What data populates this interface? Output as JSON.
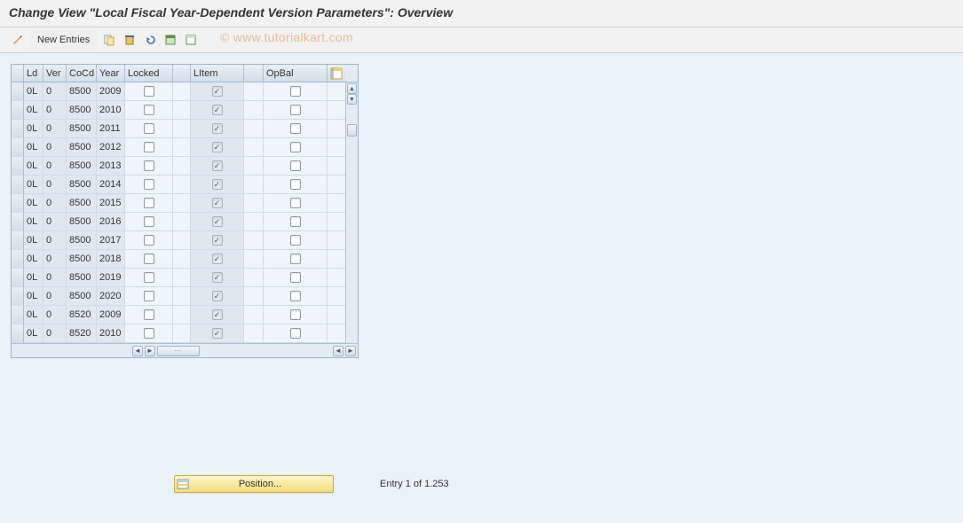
{
  "header": {
    "title": "Change View \"Local Fiscal Year-Dependent Version Parameters\": Overview"
  },
  "toolbar": {
    "new_entries": "New Entries"
  },
  "watermark": "© www.tutorialkart.com",
  "table": {
    "columns": {
      "ld": "Ld",
      "ver": "Ver",
      "cocd": "CoCd",
      "year": "Year",
      "locked": "Locked",
      "litem": "LItem",
      "opbal": "OpBal"
    },
    "rows": [
      {
        "ld": "0L",
        "ver": "0",
        "cocd": "8500",
        "year": "2009",
        "locked": false,
        "litem": true,
        "opbal": false
      },
      {
        "ld": "0L",
        "ver": "0",
        "cocd": "8500",
        "year": "2010",
        "locked": false,
        "litem": true,
        "opbal": false
      },
      {
        "ld": "0L",
        "ver": "0",
        "cocd": "8500",
        "year": "2011",
        "locked": false,
        "litem": true,
        "opbal": false
      },
      {
        "ld": "0L",
        "ver": "0",
        "cocd": "8500",
        "year": "2012",
        "locked": false,
        "litem": true,
        "opbal": false
      },
      {
        "ld": "0L",
        "ver": "0",
        "cocd": "8500",
        "year": "2013",
        "locked": false,
        "litem": true,
        "opbal": false
      },
      {
        "ld": "0L",
        "ver": "0",
        "cocd": "8500",
        "year": "2014",
        "locked": false,
        "litem": true,
        "opbal": false
      },
      {
        "ld": "0L",
        "ver": "0",
        "cocd": "8500",
        "year": "2015",
        "locked": false,
        "litem": true,
        "opbal": false
      },
      {
        "ld": "0L",
        "ver": "0",
        "cocd": "8500",
        "year": "2016",
        "locked": false,
        "litem": true,
        "opbal": false
      },
      {
        "ld": "0L",
        "ver": "0",
        "cocd": "8500",
        "year": "2017",
        "locked": false,
        "litem": true,
        "opbal": false
      },
      {
        "ld": "0L",
        "ver": "0",
        "cocd": "8500",
        "year": "2018",
        "locked": false,
        "litem": true,
        "opbal": false
      },
      {
        "ld": "0L",
        "ver": "0",
        "cocd": "8500",
        "year": "2019",
        "locked": false,
        "litem": true,
        "opbal": false
      },
      {
        "ld": "0L",
        "ver": "0",
        "cocd": "8500",
        "year": "2020",
        "locked": false,
        "litem": true,
        "opbal": false
      },
      {
        "ld": "0L",
        "ver": "0",
        "cocd": "8520",
        "year": "2009",
        "locked": false,
        "litem": true,
        "opbal": false
      },
      {
        "ld": "0L",
        "ver": "0",
        "cocd": "8520",
        "year": "2010",
        "locked": false,
        "litem": true,
        "opbal": false
      }
    ]
  },
  "footer": {
    "position_label": "Position...",
    "entry_text": "Entry 1 of 1.253"
  }
}
